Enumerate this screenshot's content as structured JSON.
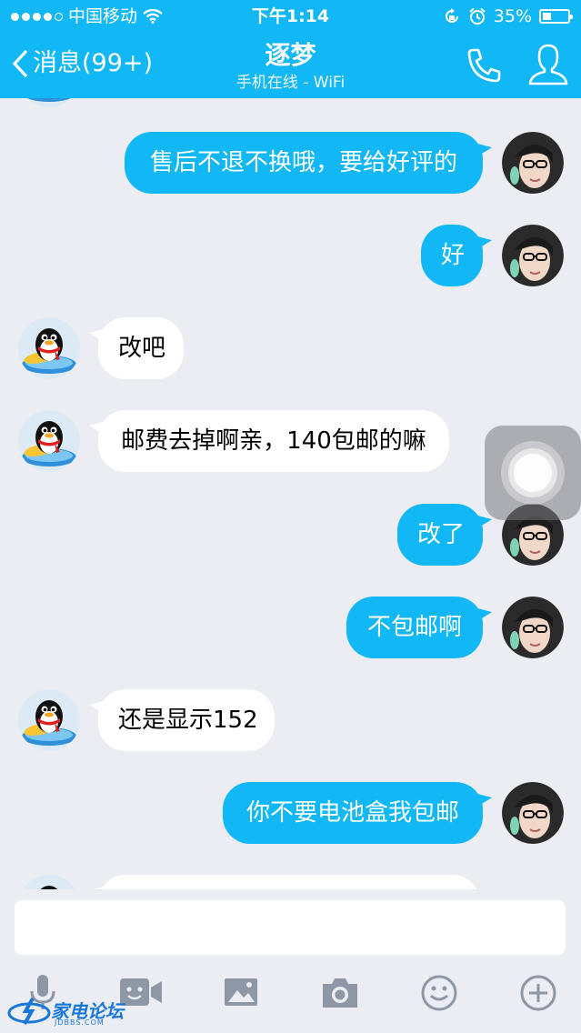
{
  "status_bar": {
    "carrier": "中国移动",
    "time": "下午1:14",
    "battery": "35%",
    "battery_level": 0.35
  },
  "header": {
    "back_label": "消息(99+)",
    "title": "逐梦",
    "subtitle": "手机在线 - WiFi"
  },
  "messages": [
    {
      "side": "out",
      "text": "售后不退不换哦，要给好评的"
    },
    {
      "side": "out",
      "text": "好"
    },
    {
      "side": "in",
      "text": "改吧"
    },
    {
      "side": "in",
      "text": "邮费去掉啊亲，140包邮的嘛"
    },
    {
      "side": "out",
      "text": "改了"
    },
    {
      "side": "out",
      "text": "不包邮啊"
    },
    {
      "side": "in",
      "text": "还是显示152"
    },
    {
      "side": "out",
      "text": "你不要电池盒我包邮"
    }
  ],
  "input": {
    "placeholder": ""
  },
  "toolbar": [
    "mic-icon",
    "video-icon",
    "image-icon",
    "camera-icon",
    "emoji-icon",
    "plus-icon"
  ],
  "watermark": {
    "text": "家电论坛",
    "sub": "JDBBS.COM"
  },
  "colors": {
    "accent": "#12B7F5",
    "background": "#EBEDF2",
    "incoming_bubble": "#FFFFFF",
    "icon_gray": "#8E97A6"
  }
}
